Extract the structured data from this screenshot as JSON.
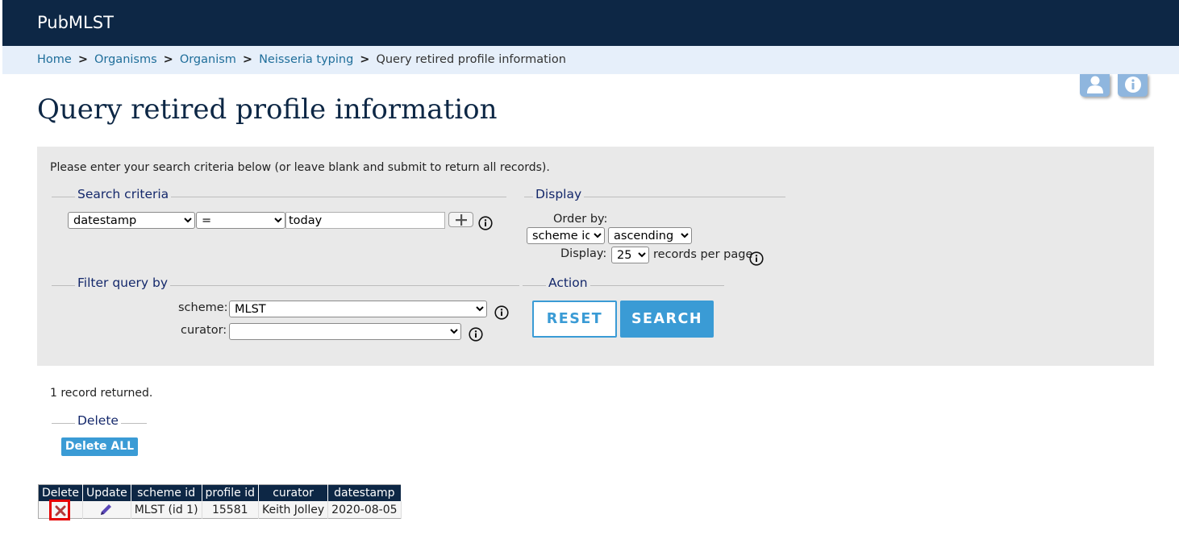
{
  "header": {
    "brand": "PubMLST"
  },
  "breadcrumb": {
    "items": [
      "Home",
      "Organisms",
      "Organism",
      "Neisseria typing"
    ],
    "separator": ">",
    "current": "Query retired profile information"
  },
  "page": {
    "title": "Query retired profile information"
  },
  "form": {
    "intro": "Please enter your search criteria below (or leave blank and submit to return all records).",
    "search_criteria": {
      "legend": "Search criteria",
      "field": "datestamp",
      "operator": "=",
      "value": "today"
    },
    "display": {
      "legend": "Display",
      "order_by_label": "Order by:",
      "order_by": "scheme id",
      "direction": "ascending",
      "display_label": "Display:",
      "per_page": "25",
      "per_page_suffix": "records per page"
    },
    "filter": {
      "legend": "Filter query by",
      "scheme_label": "scheme:",
      "scheme": "MLST",
      "curator_label": "curator:",
      "curator": ""
    },
    "action": {
      "legend": "Action",
      "reset": "RESET",
      "search": "SEARCH"
    }
  },
  "results": {
    "count_text": "1 record returned.",
    "delete_legend": "Delete",
    "delete_all": "Delete ALL",
    "columns": [
      "Delete",
      "Update",
      "scheme id",
      "profile id",
      "curator",
      "datestamp"
    ],
    "rows": [
      {
        "scheme_id": "MLST (id 1)",
        "profile_id": "15581",
        "curator": "Keith Jolley",
        "datestamp": "2020-08-05"
      }
    ]
  },
  "colors": {
    "header_bg": "#0d2745",
    "breadcrumb_bg": "#e6effa",
    "accent": "#3a9bd5",
    "highlight": "#e60000"
  }
}
